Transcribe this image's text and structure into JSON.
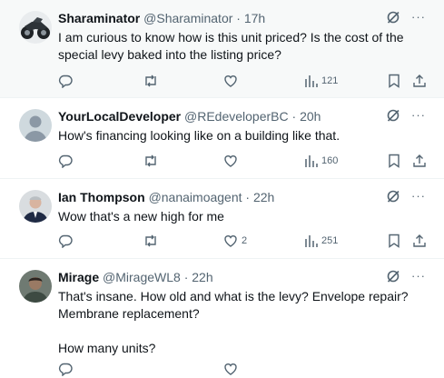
{
  "replies": [
    {
      "name": "Sharaminator",
      "handle": "@Sharaminator",
      "time": "· 17h",
      "lines": [
        "I am curious to know how is this unit priced? Is the cost of the",
        "special levy baked into the listing price?"
      ],
      "reply_count": "",
      "retweet_count": "",
      "like_count": "",
      "view_count": "121",
      "avatar": "motorcycle-avatar",
      "more_label": "···"
    },
    {
      "name": "YourLocalDeveloper",
      "handle": "@REdeveloperBC",
      "time": "· 20h",
      "lines": [
        "How's financing looking like on a building like that."
      ],
      "reply_count": "",
      "retweet_count": "",
      "like_count": "",
      "view_count": "160",
      "avatar": "default-avatar",
      "more_label": "···"
    },
    {
      "name": "Ian Thompson",
      "handle": "@nanaimoagent",
      "time": "· 22h",
      "lines": [
        "Wow that's a new high for me"
      ],
      "reply_count": "",
      "retweet_count": "",
      "like_count": "2",
      "view_count": "251",
      "avatar": "person-avatar",
      "more_label": "···"
    },
    {
      "name": "Mirage",
      "handle": "@MirageWL8",
      "time": "· 22h",
      "lines": [
        "That's insane. How old and what is the levy? Envelope repair?",
        "Membrane replacement?",
        "",
        "How many units?"
      ],
      "reply_count": "",
      "retweet_count": "",
      "like_count": "",
      "view_count": "",
      "avatar": "person-avatar",
      "more_label": "···"
    }
  ],
  "colors": {
    "text": "#0f1419",
    "muted": "#536471",
    "divider": "#eff3f4",
    "highlight_bg": "#f7f9f9"
  }
}
